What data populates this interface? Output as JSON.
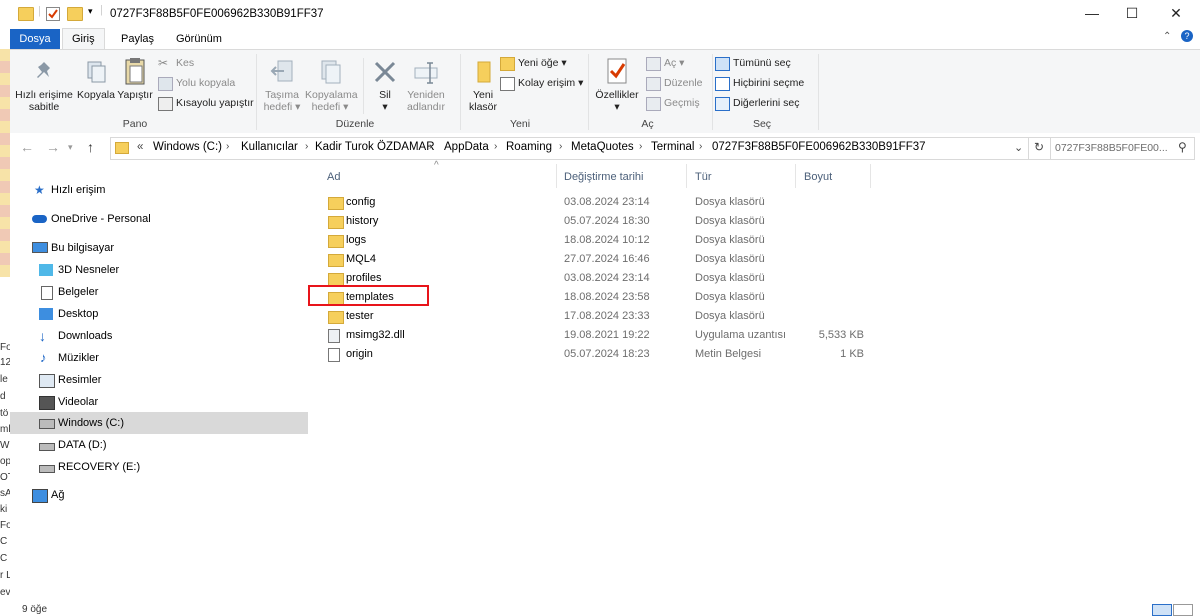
{
  "window": {
    "title": "0727F3F88B5F0FE006962B330B91FF37",
    "controls": {
      "minimize": "—",
      "maximize": "☐",
      "close": "✕"
    }
  },
  "ribbon_tabs": [
    "Dosya",
    "Giriş",
    "Paylaş",
    "Görünüm"
  ],
  "ribbon": {
    "groups": {
      "pano": "Pano",
      "duzenle": "Düzenle",
      "yeni": "Yeni",
      "ac": "Aç",
      "sec": "Seç"
    },
    "pin": {
      "line1": "Hızlı erişime",
      "line2": "sabitle"
    },
    "copy": "Kopyala",
    "paste": "Yapıştır",
    "cut": "Kes",
    "copy_path": "Yolu kopyala",
    "paste_shortcut": "Kısayolu yapıştır",
    "move_to": {
      "line1": "Taşıma",
      "line2": "hedefi ▾"
    },
    "copy_to": {
      "line1": "Kopyalama",
      "line2": "hedefi ▾"
    },
    "delete": {
      "line1": "Sil",
      "line2": "▾"
    },
    "rename": {
      "line1": "Yeniden",
      "line2": "adlandır"
    },
    "new_folder": {
      "line1": "Yeni",
      "line2": "klasör"
    },
    "new_item": "Yeni öğe ▾",
    "easy_access": "Kolay erişim ▾",
    "properties": {
      "line1": "Özellikler",
      "line2": "▾"
    },
    "open": "Aç ▾",
    "edit": "Düzenle",
    "history": "Geçmiş",
    "select_all": "Tümünü seç",
    "select_none": "Hiçbirini seçme",
    "invert_selection": "Diğerlerini seç"
  },
  "address": {
    "prefix": "«",
    "crumbs": [
      "Windows (C:)",
      "Kullanıcılar",
      "Kadir Turok ÖZDAMAR",
      "AppData",
      "Roaming",
      "MetaQuotes",
      "Terminal",
      "0727F3F88B5F0FE006962B330B91FF37"
    ],
    "search_placeholder": "0727F3F88B5F0FE00..."
  },
  "nav": {
    "quick_access": "Hızlı erişim",
    "onedrive": "OneDrive - Personal",
    "this_pc": "Bu bilgisayar",
    "items": [
      "3D Nesneler",
      "Belgeler",
      "Desktop",
      "Downloads",
      "Müzikler",
      "Resimler",
      "Videolar",
      "Windows (C:)",
      "DATA (D:)",
      "RECOVERY (E:)"
    ],
    "network": "Ağ"
  },
  "columns": {
    "name": "Ad",
    "date": "Değiştirme tarihi",
    "type": "Tür",
    "size": "Boyut"
  },
  "files": [
    {
      "name": "config",
      "date": "03.08.2024 23:14",
      "type": "Dosya klasörü",
      "size": "",
      "kind": "folder"
    },
    {
      "name": "history",
      "date": "05.07.2024 18:30",
      "type": "Dosya klasörü",
      "size": "",
      "kind": "folder"
    },
    {
      "name": "logs",
      "date": "18.08.2024 10:12",
      "type": "Dosya klasörü",
      "size": "",
      "kind": "folder"
    },
    {
      "name": "MQL4",
      "date": "27.07.2024 16:46",
      "type": "Dosya klasörü",
      "size": "",
      "kind": "folder"
    },
    {
      "name": "profiles",
      "date": "03.08.2024 23:14",
      "type": "Dosya klasörü",
      "size": "",
      "kind": "folder"
    },
    {
      "name": "templates",
      "date": "18.08.2024 23:58",
      "type": "Dosya klasörü",
      "size": "",
      "kind": "folder"
    },
    {
      "name": "tester",
      "date": "17.08.2024 23:33",
      "type": "Dosya klasörü",
      "size": "",
      "kind": "folder"
    },
    {
      "name": "msimg32.dll",
      "date": "19.08.2021 19:22",
      "type": "Uygulama uzantısı",
      "size": "5,533 KB",
      "kind": "dll"
    },
    {
      "name": "origin",
      "date": "05.07.2024 18:23",
      "type": "Metin Belgesi",
      "size": "1 KB",
      "kind": "text"
    }
  ],
  "status": {
    "count": "9 öğe"
  },
  "background_window_text": [
    "Fo",
    "12",
    "le",
    "d",
    "tö",
    "ml",
    "Wi",
    "op",
    "OT",
    "sA",
    "ki",
    "Fo",
    "C",
    "C",
    "r L",
    "ev"
  ],
  "colors": {
    "file_tab": "#1a64c5",
    "folder": "#f6cf5c",
    "highlight_box": "#e8141a",
    "selected_nav": "#d9d9d9"
  }
}
